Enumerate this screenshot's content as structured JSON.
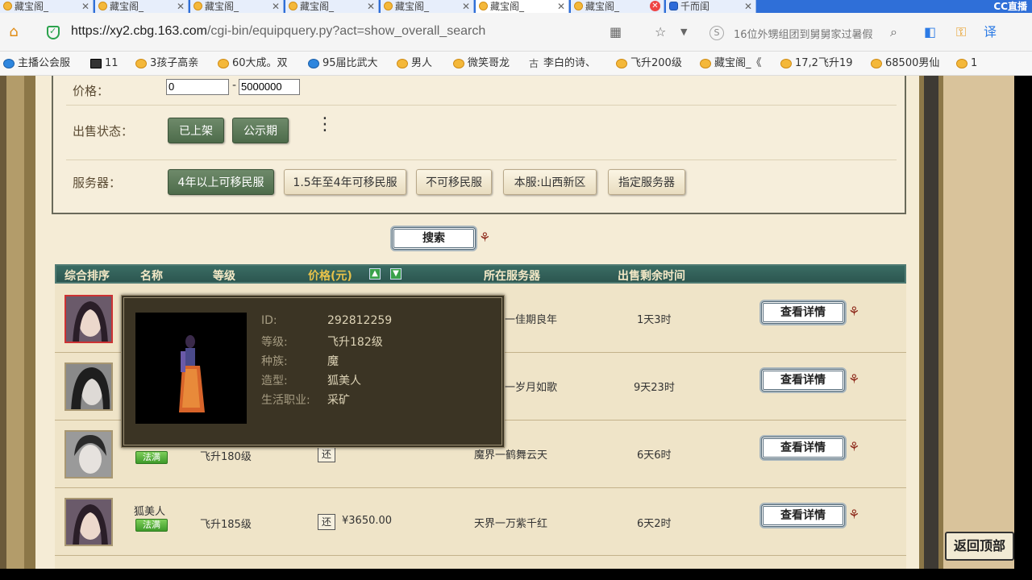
{
  "browser": {
    "tabs": [
      {
        "label": "藏宝阁_",
        "icon": "cbg-favicon"
      },
      {
        "label": "藏宝阁_",
        "icon": "cbg-favicon"
      },
      {
        "label": "藏宝阁_",
        "icon": "cbg-favicon"
      },
      {
        "label": "藏宝阁_",
        "icon": "cbg-favicon"
      },
      {
        "label": "藏宝阁_",
        "icon": "cbg-favicon"
      },
      {
        "label": "藏宝阁_",
        "icon": "cbg-favicon"
      },
      {
        "label": "藏宝阁_",
        "icon": "cbg-favicon"
      },
      {
        "label": "千而闺",
        "icon": "baidu-favicon"
      }
    ],
    "cc_logo": "CC直播",
    "url_host": "https://xy2.cbg.163.com",
    "url_path": "/cgi-bin/equipquery.py?act=show_overall_search",
    "search_hint": "16位外甥组团到舅舅家过暑假",
    "bookmarks": [
      {
        "label": "主播公会服",
        "icon": "globe"
      },
      {
        "label": "11",
        "icon": "dark"
      },
      {
        "label": "3孩子高亲",
        "icon": "cbg"
      },
      {
        "label": "60大成。双",
        "icon": "cbg"
      },
      {
        "label": "95届比武大",
        "icon": "globe"
      },
      {
        "label": "男人",
        "icon": "cbg"
      },
      {
        "label": "微笑哥龙",
        "icon": "cbg"
      },
      {
        "label": "李白的诗、",
        "icon": "poem"
      },
      {
        "label": "飞升200级",
        "icon": "cbg"
      },
      {
        "label": "藏宝阁_《",
        "icon": "cbg"
      },
      {
        "label": "17,2飞升19",
        "icon": "cbg"
      },
      {
        "label": "68500男仙",
        "icon": "cbg"
      },
      {
        "label": "1",
        "icon": "cbg"
      }
    ]
  },
  "filters": {
    "price_label": "价格：",
    "price_min": "0",
    "price_max": "5000000",
    "status_label": "出售状态：",
    "status_options": [
      "已上架",
      "公示期"
    ],
    "server_label": "服务器：",
    "server_options": [
      "4年以上可移民服",
      "1.5年至4年可移民服",
      "不可移民服",
      "本服:山西新区",
      "指定服务器"
    ]
  },
  "search_button": "搜索",
  "table": {
    "headers": [
      "综合排序",
      "名称",
      "等级",
      "价格(元)",
      "所在服务器",
      "出售剩余时间"
    ],
    "rows": [
      {
        "name": "",
        "badge": "",
        "level": "",
        "price": "",
        "server": "一佳期良年",
        "time": "1天3时",
        "detail": "查看详情"
      },
      {
        "name": "",
        "badge": "",
        "level": "",
        "price": "",
        "server": "一岁月如歌",
        "time": "9天23时",
        "detail": "查看详情"
      },
      {
        "name": "",
        "badge": "法满",
        "level": "飞升180级",
        "price": "",
        "server": "魔界一鹤舞云天",
        "time": "6天6时",
        "detail": "查看详情"
      },
      {
        "name": "狐美人",
        "badge": "法满",
        "level": "飞升185级",
        "price": "¥3650.00",
        "server": "天界一万紫千红",
        "time": "6天2时",
        "detail": "查看详情"
      }
    ],
    "return_tag": "还"
  },
  "popup": {
    "id_label": "ID:",
    "id_value": "292812259",
    "level_label": "等级:",
    "level_value": "飞升182级",
    "race_label": "种族:",
    "race_value": "魔",
    "model_label": "造型:",
    "model_value": "狐美人",
    "job_label": "生活职业:",
    "job_value": "采矿"
  },
  "back_to_top": "返回顶部",
  "colors": {
    "tab_bar": "#2f6fd8",
    "header_bg": "#2c5650",
    "dark_button": "#4d6b4a",
    "badge_green": "#3e9a2a",
    "popup_bg": "#3b3424"
  }
}
